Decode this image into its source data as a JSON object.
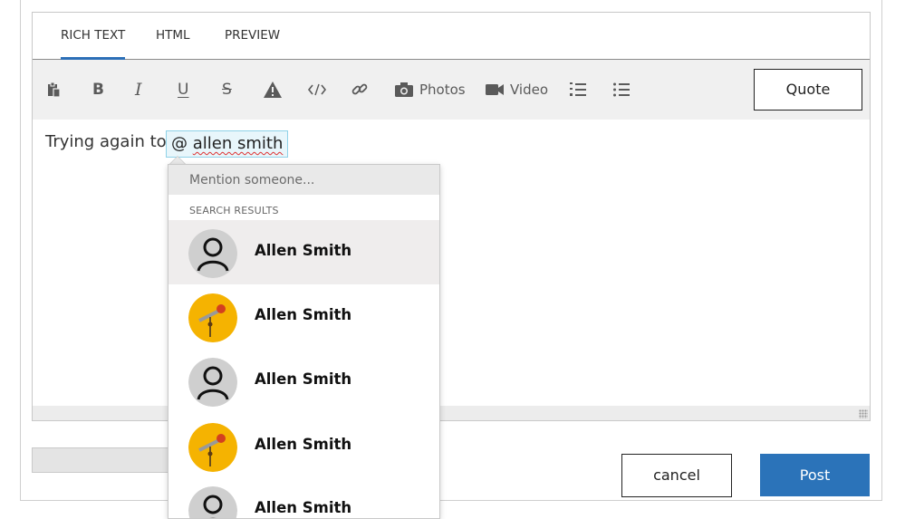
{
  "tabs": [
    {
      "label": "RICH TEXT"
    },
    {
      "label": "HTML"
    },
    {
      "label": "PREVIEW"
    }
  ],
  "toolbar": {
    "photos_label": "Photos",
    "video_label": "Video",
    "quote_label": "Quote"
  },
  "editor": {
    "text": "Trying again to",
    "mention_at": "@",
    "mention_word": "allen smith"
  },
  "mention_popup": {
    "placeholder": "Mention someone...",
    "results_header": "SEARCH RESULTS",
    "results": [
      {
        "name": "Allen Smith",
        "avatar": "default-person-icon"
      },
      {
        "name": "Allen Smith",
        "avatar": "telescope-avatar"
      },
      {
        "name": "Allen Smith",
        "avatar": "default-person-icon"
      },
      {
        "name": "Allen Smith",
        "avatar": "telescope-avatar"
      },
      {
        "name": "Allen Smith",
        "avatar": "default-person-icon"
      }
    ]
  },
  "actions": {
    "cancel_label": "cancel",
    "post_label": "Post"
  },
  "colors": {
    "accent": "#2b73b9",
    "mention_bg": "#e8f6fb",
    "avatar_yellow": "#f5b301"
  }
}
